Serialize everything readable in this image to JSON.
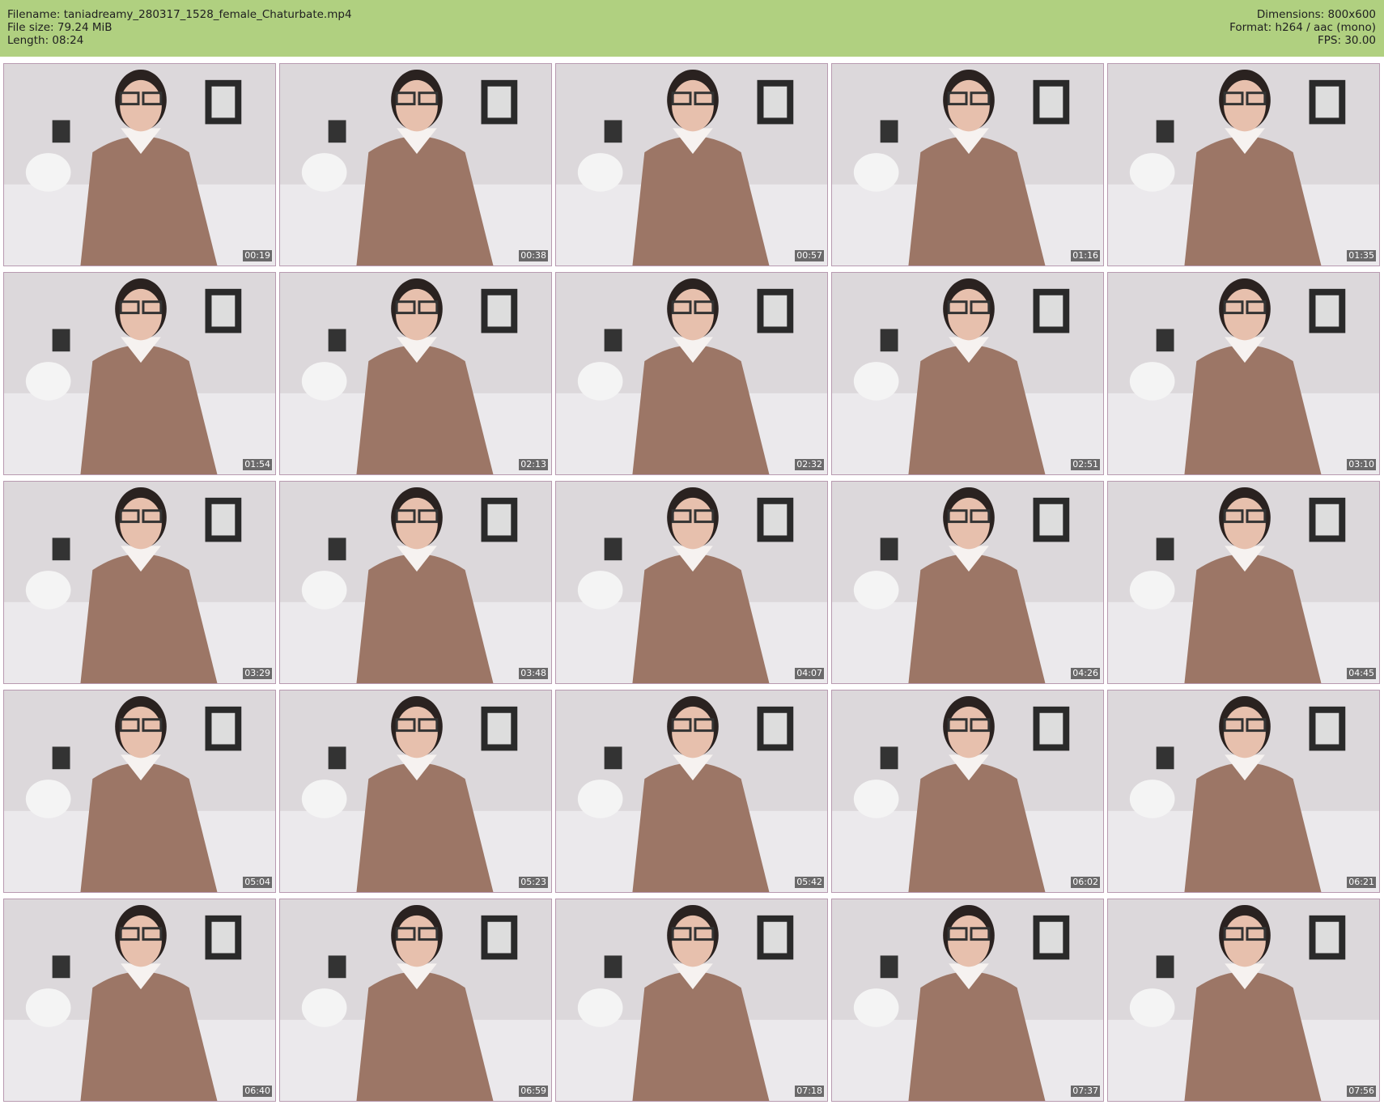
{
  "header": {
    "filename_line": "Filename: taniadreamy_280317_1528_female_Chaturbate.mp4",
    "filesize_line": "File size: 79.24 MiB",
    "length_line": "Length: 08:24",
    "dimensions_line": "Dimensions: 800x600",
    "format_line": "Format: h264 / aac (mono)",
    "fps_line": "FPS: 30.00"
  },
  "colors": {
    "header_bg": "#b0d080",
    "thumb_border": "#b89ab0",
    "wall": "#dcd8db",
    "dress": "#9c7666",
    "collar": "#f6f2f0",
    "hair": "#2a2220",
    "skin": "#e7c0ad"
  },
  "thumbnails": [
    {
      "time": "00:19"
    },
    {
      "time": "00:38"
    },
    {
      "time": "00:57"
    },
    {
      "time": "01:16"
    },
    {
      "time": "01:35"
    },
    {
      "time": "01:54"
    },
    {
      "time": "02:13"
    },
    {
      "time": "02:32"
    },
    {
      "time": "02:51"
    },
    {
      "time": "03:10"
    },
    {
      "time": "03:29"
    },
    {
      "time": "03:48"
    },
    {
      "time": "04:07"
    },
    {
      "time": "04:26"
    },
    {
      "time": "04:45"
    },
    {
      "time": "05:04"
    },
    {
      "time": "05:23"
    },
    {
      "time": "05:42"
    },
    {
      "time": "06:02"
    },
    {
      "time": "06:21"
    },
    {
      "time": "06:40"
    },
    {
      "time": "06:59"
    },
    {
      "time": "07:18"
    },
    {
      "time": "07:37"
    },
    {
      "time": "07:56"
    }
  ]
}
